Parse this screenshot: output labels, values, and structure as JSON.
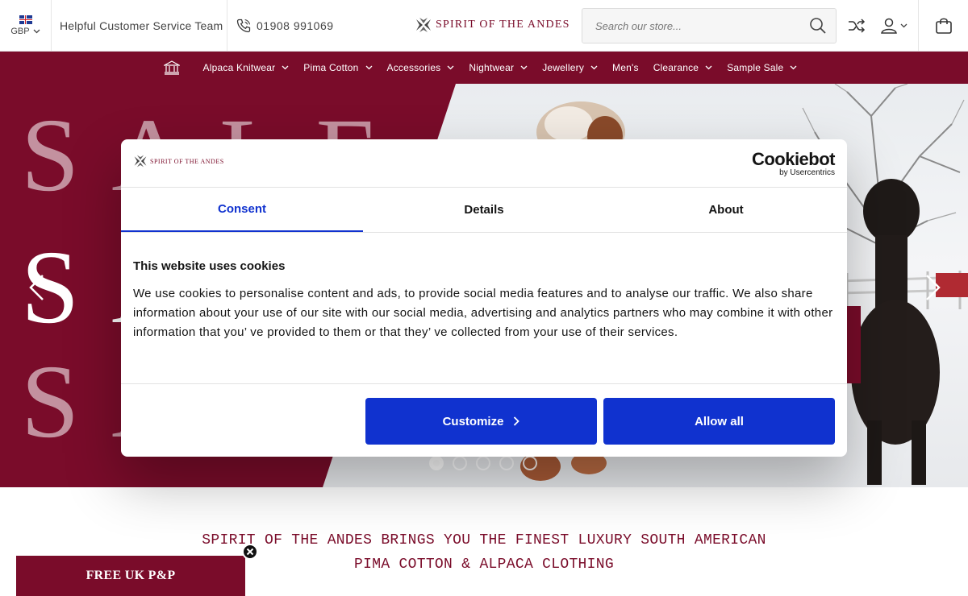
{
  "header": {
    "currency": "GBP",
    "service_label": "Helpful Customer Service Team",
    "phone": "01908 991069",
    "brand": "SPIRIT OF THE ANDES",
    "search_placeholder": "Search our store..."
  },
  "nav": {
    "items": [
      {
        "label": "Alpaca Knitwear",
        "dropdown": true
      },
      {
        "label": "Pima Cotton",
        "dropdown": true
      },
      {
        "label": "Accessories",
        "dropdown": true
      },
      {
        "label": "Nightwear",
        "dropdown": true
      },
      {
        "label": "Jewellery",
        "dropdown": true
      },
      {
        "label": "Men's",
        "dropdown": false
      },
      {
        "label": "Clearance",
        "dropdown": true
      },
      {
        "label": "Sample Sale",
        "dropdown": true
      }
    ]
  },
  "hero": {
    "word": "SALE",
    "slide_count": 5,
    "active_slide": 1
  },
  "cookie": {
    "brand": "SPIRIT OF THE ANDES",
    "provider": "Cookiebot",
    "provider_sub": "by Usercentrics",
    "tabs": [
      "Consent",
      "Details",
      "About"
    ],
    "active_tab": "Consent",
    "title": "This website uses cookies",
    "body": "We use cookies to personalise content and ads, to provide social media features and to analyse our traffic. We also share information about your use of our site with our social media, advertising and analytics partners who may combine it with other information that you’ ve provided to them or that they’ ve collected from your use of their services.",
    "customize_label": "Customize",
    "allow_label": "Allow all"
  },
  "tagline": {
    "line1": "SPIRIT OF THE ANDES BRINGS YOU THE FINEST LUXURY SOUTH AMERICAN",
    "line2": "PIMA COTTON & ALPACA CLOTHING"
  },
  "shipping": {
    "label": "FREE UK P&P"
  },
  "colors": {
    "brand": "#7a0c2a",
    "cookie_accent": "#1032cf"
  }
}
